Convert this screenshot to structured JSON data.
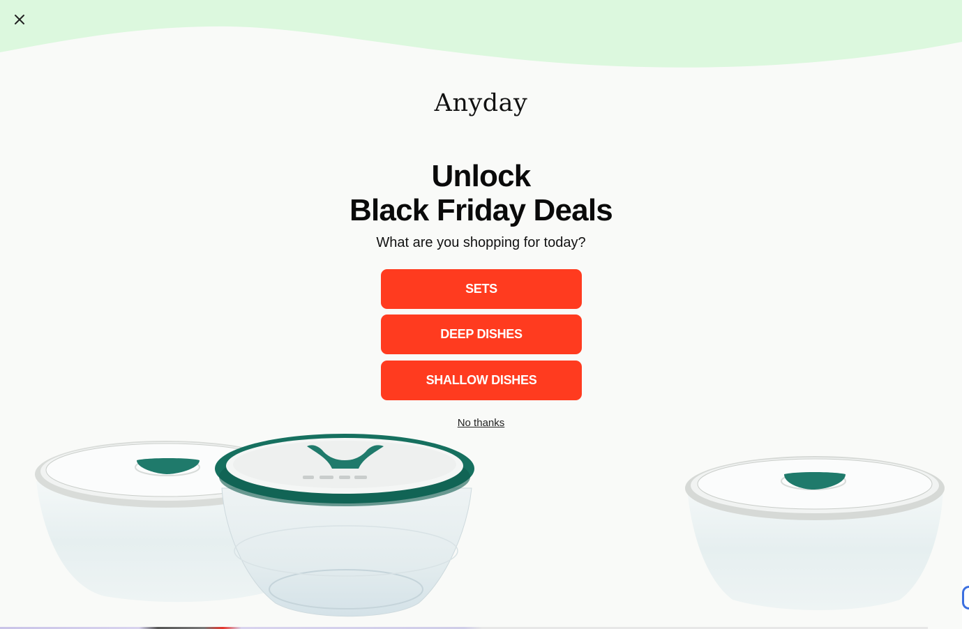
{
  "popup": {
    "close_icon": "close-icon",
    "logo_text": "Anyday",
    "headline_line1": "Unlock",
    "headline_line2": "Black Friday Deals",
    "subhead": "What are you shopping for today?",
    "buttons": [
      {
        "label": "SETS"
      },
      {
        "label": "DEEP DISHES"
      },
      {
        "label": "SHALLOW DISHES"
      }
    ],
    "dismiss_label": "No thanks",
    "product_images": [
      "frosted-white-deep-dish",
      "clear-glass-deep-dish-green-lid",
      "frosted-white-shallow-dish"
    ]
  },
  "colors": {
    "background": "#f9faf8",
    "wave": "#dcf8de",
    "button": "#ff3b1f",
    "button_text": "#ffffff",
    "lid_knob": "#1f7a6b",
    "lid_rim_green": "#16705f"
  }
}
